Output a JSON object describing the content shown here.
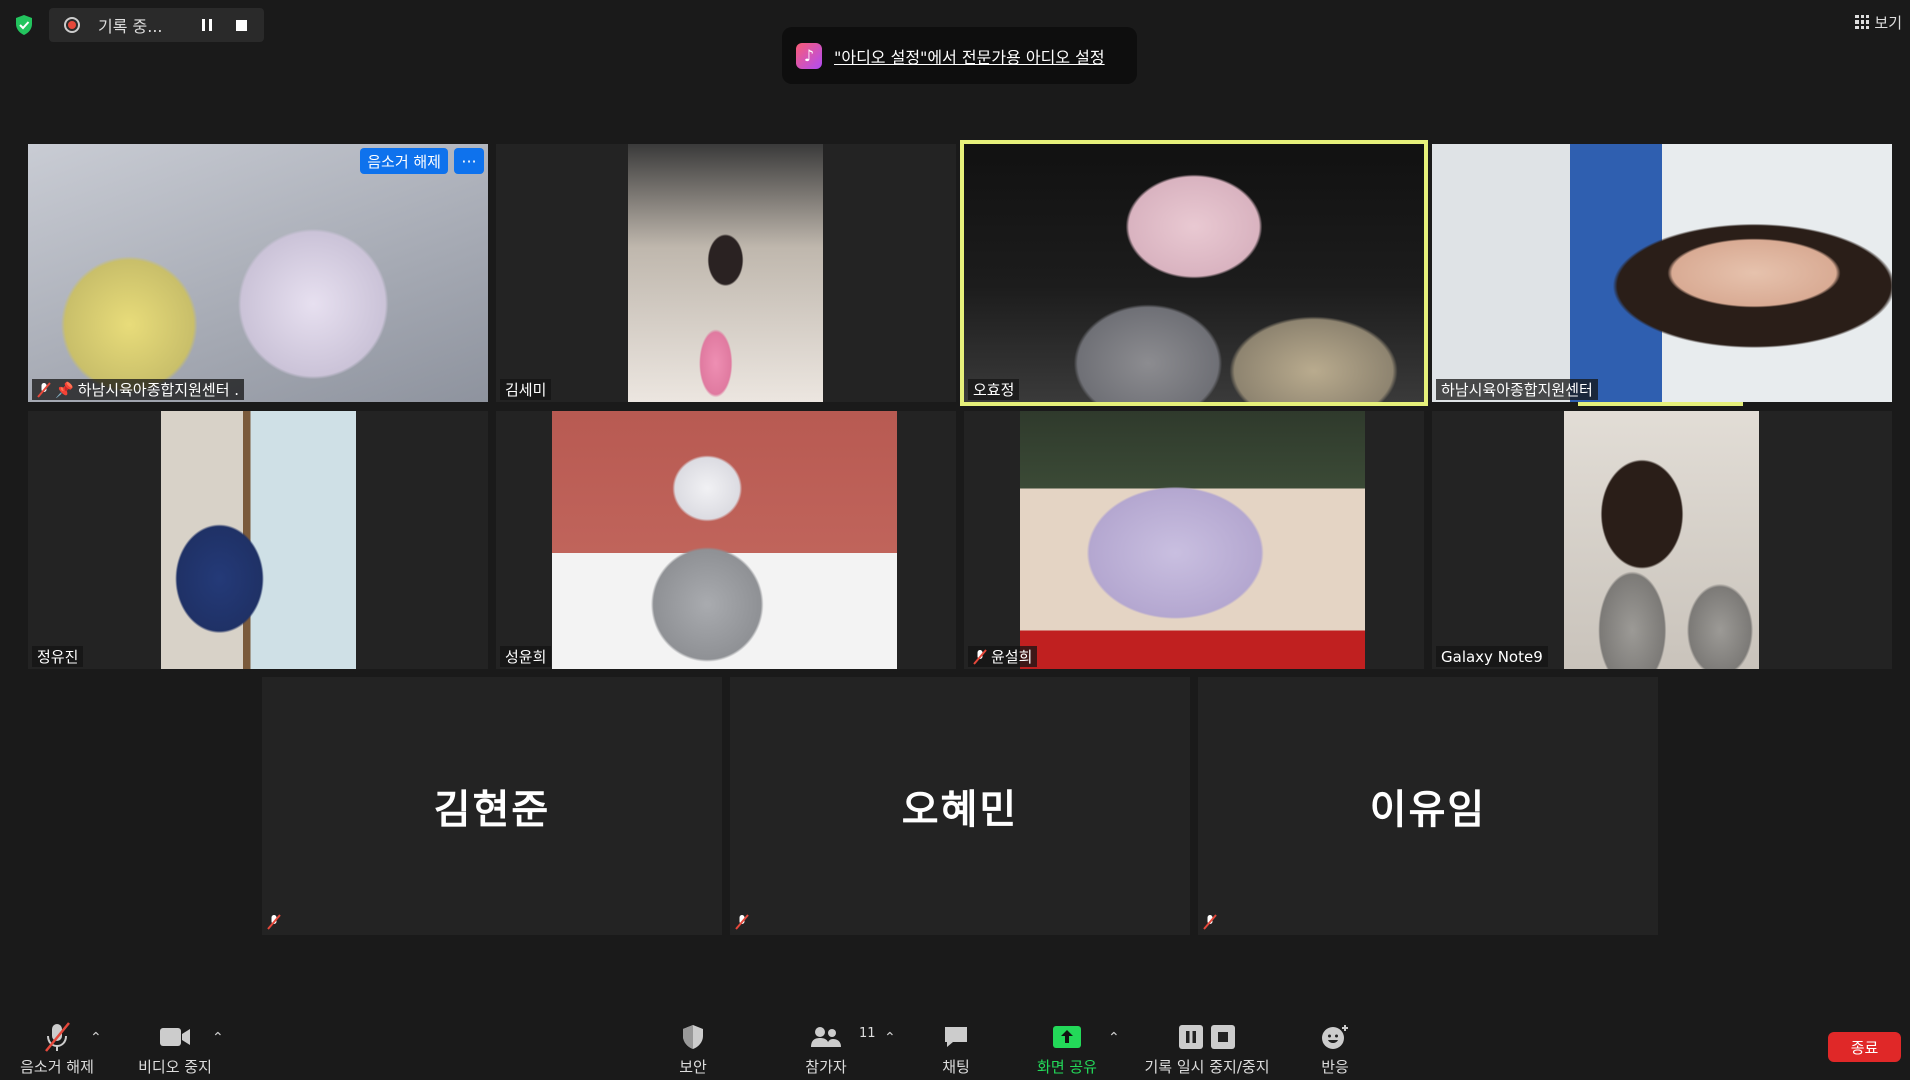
{
  "top": {
    "recording_label": "기록 중...",
    "view_label": "보기",
    "banner_text": "\"아디오 설정\"에서 전문가용 아디오 설정"
  },
  "tiles": [
    {
      "name": "하남시육아종합지원센터 .",
      "unmute_label": "음소거 해제",
      "more_label": "···"
    },
    {
      "name": "김세미"
    },
    {
      "name": "오효정"
    },
    {
      "name": "하남시육아종합지원센터"
    },
    {
      "name": "정유진"
    },
    {
      "name": "성윤희"
    },
    {
      "name": "윤설희"
    },
    {
      "name": "Galaxy Note9"
    }
  ],
  "placeholders": [
    {
      "name": "김현준"
    },
    {
      "name": "오혜민"
    },
    {
      "name": "이유임"
    }
  ],
  "toolbar": {
    "mute_label": "음소거 해제",
    "video_label": "비디오 중지",
    "security_label": "보안",
    "participants_label": "참가자",
    "participants_count": "11",
    "chat_label": "채팅",
    "share_label": "화면 공유",
    "record_label": "기록 일시 중지/중지",
    "reactions_label": "반응",
    "end_label": "종료"
  },
  "colors": {
    "accent_blue": "#0e72ed",
    "active_speaker": "#e6f07a",
    "share_green": "#23d959",
    "end_red": "#e02828",
    "mute_red": "#e5483b"
  }
}
